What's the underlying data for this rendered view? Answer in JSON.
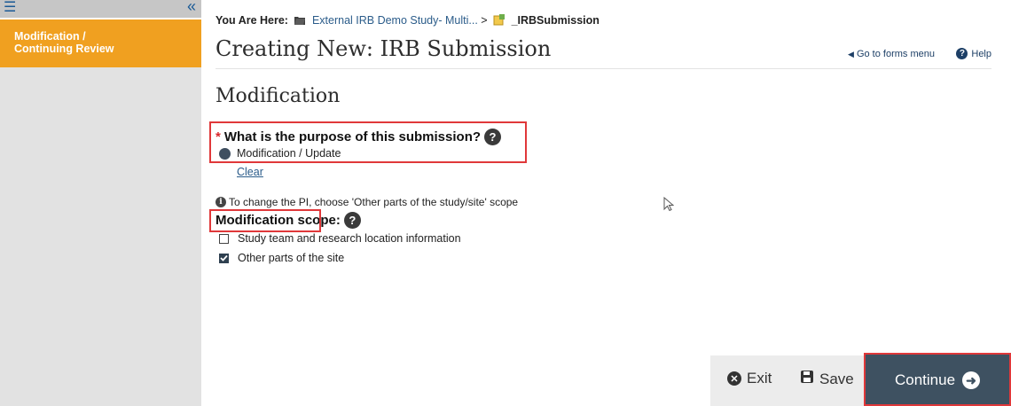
{
  "sidebar": {
    "menu_icon": "hamburger-icon",
    "collapse_icon": "double-chevron-left-icon",
    "items": [
      {
        "label": "Modification / Continuing Review"
      }
    ]
  },
  "breadcrumb": {
    "prefix": "You Are Here:",
    "study_link": "External IRB Demo Study- Multi...",
    "separator": ">",
    "current": "_IRBSubmission"
  },
  "header": {
    "title": "Creating New: IRB Submission",
    "go_to_forms": "Go to forms menu",
    "help": "Help"
  },
  "form": {
    "section_title": "Modification",
    "purpose_question": "What is the purpose of this submission?",
    "required_mark": "*",
    "purpose_selected": "Modification / Update",
    "clear_link": "Clear",
    "info_text": "To change the PI, choose 'Other parts of the study/site' scope",
    "scope_label": "Modification scope:",
    "scope_options": [
      {
        "label": "Study team and research location information",
        "checked": false
      },
      {
        "label": "Other parts of the site",
        "checked": true
      }
    ]
  },
  "footer": {
    "exit": "Exit",
    "save": "Save",
    "continue": "Continue"
  },
  "colors": {
    "sidebar_active": "#f0a020",
    "continue_bg": "#3e5161",
    "highlight_border": "#e0383a"
  }
}
